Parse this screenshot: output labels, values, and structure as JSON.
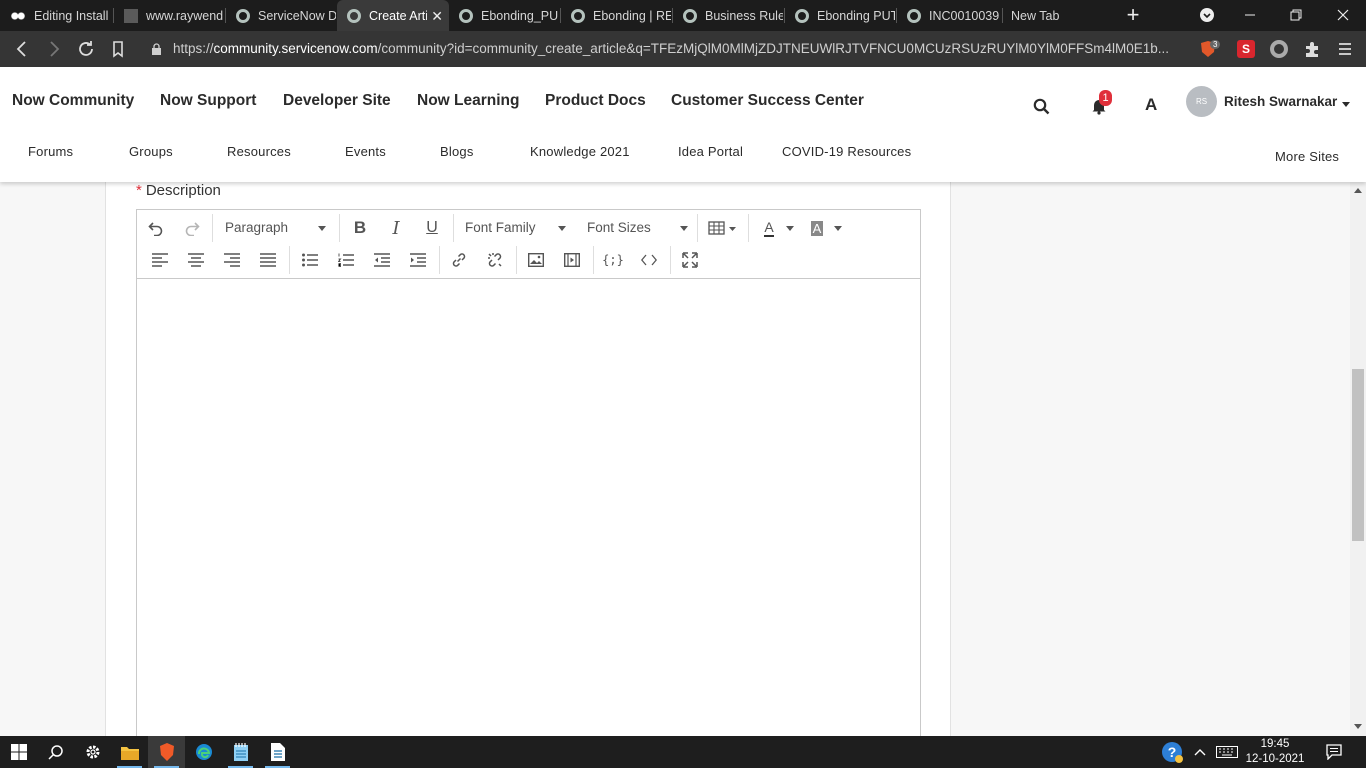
{
  "browser": {
    "tabs": [
      {
        "title": "Editing Install",
        "icon": "brave-icon"
      },
      {
        "title": "www.raywend",
        "icon": "raywenderlich-icon"
      },
      {
        "title": "ServiceNow D",
        "icon": "servicenow-icon"
      },
      {
        "title": "Create Arti",
        "icon": "servicenow-icon",
        "active": true
      },
      {
        "title": "Ebonding_PU",
        "icon": "servicenow-icon"
      },
      {
        "title": "Ebonding | RE",
        "icon": "servicenow-icon"
      },
      {
        "title": "Business Rules",
        "icon": "servicenow-icon"
      },
      {
        "title": "Ebonding PUT",
        "icon": "servicenow-icon"
      },
      {
        "title": "INC0010039 |",
        "icon": "servicenow-icon"
      },
      {
        "title": "New Tab",
        "icon": ""
      }
    ],
    "new_tab_symbol": "+",
    "url_scheme": "https://",
    "url_host": "community.servicenow.com",
    "url_rest": "/community?id=community_create_article&q=TFEzMjQlM0MlMjZDJTNEUWlRJTVFNCU0MCUzRSUzRUYlM0YlM0FFSm4lM0E1b...",
    "brave_shield_count": "3"
  },
  "site": {
    "topnav": [
      "Now Community",
      "Now Support",
      "Developer Site",
      "Now Learning",
      "Product Docs",
      "Customer Success Center"
    ],
    "subnav": [
      "Forums",
      "Groups",
      "Resources",
      "Events",
      "Blogs",
      "Knowledge 2021",
      "Idea Portal",
      "COVID-19 Resources"
    ],
    "more_sites": "More Sites",
    "notification_count": "1",
    "accessibility_glyph": "A",
    "avatar_initials": "RS",
    "user_name": "Ritesh Swarnakar"
  },
  "form": {
    "description_required_marker": "*",
    "description_label": "Description",
    "editor": {
      "block_format": "Paragraph",
      "font_family": "Font Family",
      "font_size": "Font Sizes",
      "text_color_glyph": "A",
      "bg_color_glyph": "A",
      "code_sample_glyph": "{;}",
      "content": ""
    }
  },
  "taskbar": {
    "time": "19:45",
    "date": "12-10-2021"
  },
  "colors": {
    "accent_red": "#e0303b",
    "chrome_dark": "#1c1c1c",
    "addressbar": "#353535"
  }
}
